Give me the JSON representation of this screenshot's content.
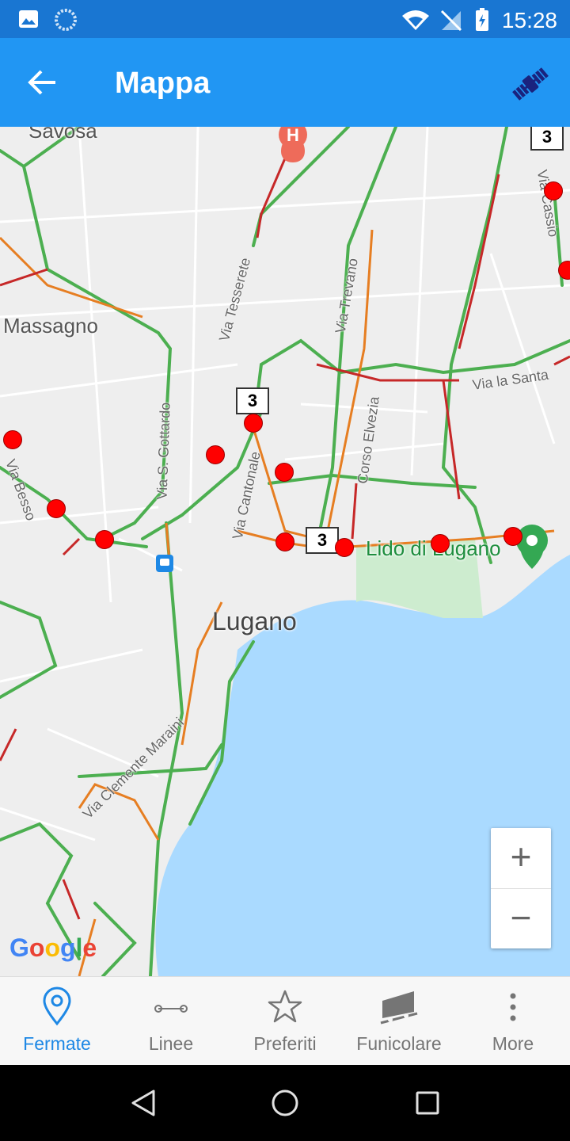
{
  "status_bar": {
    "time": "15:28"
  },
  "app_bar": {
    "title": "Mappa"
  },
  "map": {
    "place_labels": {
      "savosa": "Savosa",
      "massagno": "Massagno",
      "lugano": "Lugano",
      "lido": "Lido di Lugano"
    },
    "streets": {
      "tesserete": "Via Tesserete",
      "trevano": "Via Trevano",
      "santa": "Via la Santa",
      "gottardo": "Via S. Gottardo",
      "cantonale": "Via Cantonale",
      "elvezia": "Corso Elvezia",
      "besso": "Via Besso",
      "clemente": "Via Clemente Maraini",
      "cassio": "Via Cassio"
    },
    "route_badges": [
      "3",
      "3",
      "3"
    ],
    "zoom_in": "+",
    "zoom_out": "−",
    "attribution": "Google",
    "colors": {
      "water": "#aadaff",
      "land": "#eeeeee",
      "traffic_green": "#4caf50",
      "traffic_orange": "#e67e22",
      "traffic_red": "#c62828",
      "stop": "#ff0000"
    }
  },
  "bottom_nav": {
    "items": [
      {
        "label": "Fermate",
        "icon": "map-pin-icon",
        "active": true
      },
      {
        "label": "Linee",
        "icon": "line-icon",
        "active": false
      },
      {
        "label": "Preferiti",
        "icon": "star-icon",
        "active": false
      },
      {
        "label": "Funicolare",
        "icon": "funicular-icon",
        "active": false
      },
      {
        "label": "More",
        "icon": "more-vert-icon",
        "active": false
      }
    ]
  }
}
